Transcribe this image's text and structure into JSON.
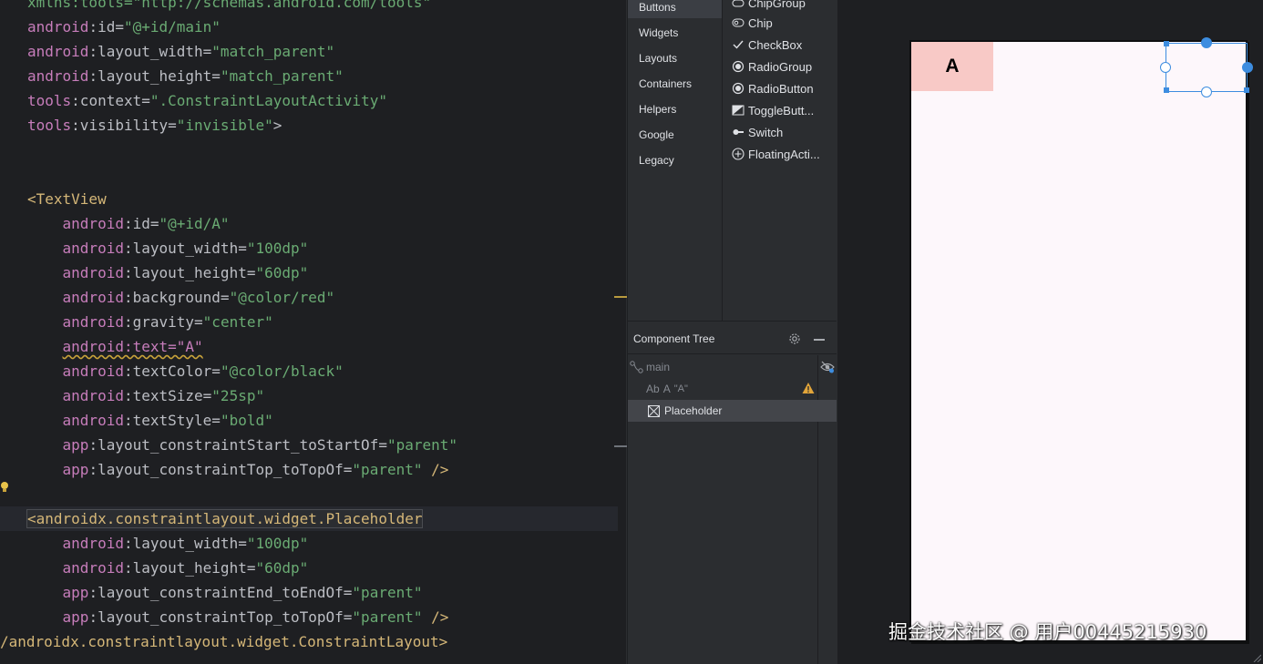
{
  "editor": {
    "lines": [
      [
        {
          "t": "xmlns:tools=\"http://schemas.android.com/tools\"",
          "c": "tok-val"
        }
      ],
      [
        {
          "t": "android",
          "c": "tok-ns"
        },
        {
          "t": ":id=",
          "c": "tok-attr"
        },
        {
          "t": "\"@+id/main\"",
          "c": "tok-val"
        }
      ],
      [
        {
          "t": "android",
          "c": "tok-ns"
        },
        {
          "t": ":layout_width=",
          "c": "tok-attr"
        },
        {
          "t": "\"match_parent\"",
          "c": "tok-val"
        }
      ],
      [
        {
          "t": "android",
          "c": "tok-ns"
        },
        {
          "t": ":layout_height=",
          "c": "tok-attr"
        },
        {
          "t": "\"match_parent\"",
          "c": "tok-val"
        }
      ],
      [
        {
          "t": "tools",
          "c": "tok-ns"
        },
        {
          "t": ":context=",
          "c": "tok-attr"
        },
        {
          "t": "\".ConstraintLayoutActivity\"",
          "c": "tok-val"
        }
      ],
      [
        {
          "t": "tools",
          "c": "tok-ns"
        },
        {
          "t": ":visibility=",
          "c": "tok-attr"
        },
        {
          "t": "\"invisible\"",
          "c": "tok-val"
        },
        {
          "t": ">",
          "c": "tok-punct"
        }
      ],
      [],
      [],
      [
        {
          "t": "<TextView",
          "c": "tok-tag"
        }
      ],
      [
        {
          "t": "    android",
          "c": "tok-ns"
        },
        {
          "t": ":id=",
          "c": "tok-attr"
        },
        {
          "t": "\"@+id/A\"",
          "c": "tok-val"
        }
      ],
      [
        {
          "t": "    android",
          "c": "tok-ns"
        },
        {
          "t": ":layout_width=",
          "c": "tok-attr"
        },
        {
          "t": "\"100dp\"",
          "c": "tok-val"
        }
      ],
      [
        {
          "t": "    android",
          "c": "tok-ns"
        },
        {
          "t": ":layout_height=",
          "c": "tok-attr"
        },
        {
          "t": "\"60dp\"",
          "c": "tok-val"
        }
      ],
      [
        {
          "t": "    android",
          "c": "tok-ns"
        },
        {
          "t": ":background=",
          "c": "tok-attr"
        },
        {
          "t": "\"@color/red\"",
          "c": "tok-val"
        }
      ],
      [
        {
          "t": "    android",
          "c": "tok-ns"
        },
        {
          "t": ":gravity=",
          "c": "tok-attr"
        },
        {
          "t": "\"center\"",
          "c": "tok-val"
        }
      ],
      [
        {
          "t": "    ",
          "c": "tok-ns"
        },
        {
          "t": "android:text=\"A\"",
          "c": "tok-ns squiggle"
        }
      ],
      [
        {
          "t": "    android",
          "c": "tok-ns"
        },
        {
          "t": ":textColor=",
          "c": "tok-attr"
        },
        {
          "t": "\"@color/black\"",
          "c": "tok-val"
        }
      ],
      [
        {
          "t": "    android",
          "c": "tok-ns"
        },
        {
          "t": ":textSize=",
          "c": "tok-attr"
        },
        {
          "t": "\"25sp\"",
          "c": "tok-val"
        }
      ],
      [
        {
          "t": "    android",
          "c": "tok-ns"
        },
        {
          "t": ":textStyle=",
          "c": "tok-attr"
        },
        {
          "t": "\"bold\"",
          "c": "tok-val"
        }
      ],
      [
        {
          "t": "    app",
          "c": "tok-ns"
        },
        {
          "t": ":layout_constraintStart_toStartOf=",
          "c": "tok-attr"
        },
        {
          "t": "\"parent\"",
          "c": "tok-val"
        }
      ],
      [
        {
          "t": "    app",
          "c": "tok-ns"
        },
        {
          "t": ":layout_constraintTop_toTopOf=",
          "c": "tok-attr"
        },
        {
          "t": "\"parent\"",
          "c": "tok-val"
        },
        {
          "t": " />",
          "c": "tok-tag"
        }
      ],
      [],
      [
        {
          "t": "<androidx.constraintlayout.widget.Placeholder",
          "c": "tok-tag tag-box"
        }
      ],
      [
        {
          "t": "    android",
          "c": "tok-ns"
        },
        {
          "t": ":layout_width=",
          "c": "tok-attr"
        },
        {
          "t": "\"100dp\"",
          "c": "tok-val"
        }
      ],
      [
        {
          "t": "    android",
          "c": "tok-ns"
        },
        {
          "t": ":layout_height=",
          "c": "tok-attr"
        },
        {
          "t": "\"60dp\"",
          "c": "tok-val"
        }
      ],
      [
        {
          "t": "    app",
          "c": "tok-ns"
        },
        {
          "t": ":layout_constraintEnd_toEndOf=",
          "c": "tok-attr"
        },
        {
          "t": "\"parent\"",
          "c": "tok-val"
        }
      ],
      [
        {
          "t": "    app",
          "c": "tok-ns"
        },
        {
          "t": ":layout_constraintTop_toTopOf=",
          "c": "tok-attr"
        },
        {
          "t": "\"parent\"",
          "c": "tok-val"
        },
        {
          "t": " />",
          "c": "tok-tag"
        }
      ],
      [
        {
          "t": "/androidx.constraintlayout.widget.ConstraintLayout>",
          "c": "tok-tag"
        }
      ]
    ]
  },
  "palette": {
    "categories": [
      "Buttons",
      "Widgets",
      "Layouts",
      "Containers",
      "Helpers",
      "Google",
      "Legacy"
    ],
    "selected_category": "Buttons",
    "items": [
      {
        "label": "ChipGroup",
        "icon": "chip-group-icon"
      },
      {
        "label": "Chip",
        "icon": "chip-icon"
      },
      {
        "label": "CheckBox",
        "icon": "checkmark-icon"
      },
      {
        "label": "RadioGroup",
        "icon": "radio-group-icon"
      },
      {
        "label": "RadioButton",
        "icon": "radio-button-icon"
      },
      {
        "label": "ToggleButt...",
        "icon": "toggle-button-icon"
      },
      {
        "label": "Switch",
        "icon": "switch-icon"
      },
      {
        "label": "FloatingActi...",
        "icon": "fab-icon"
      }
    ]
  },
  "component_tree": {
    "title": "Component Tree",
    "rows": {
      "main": "main",
      "textview_prefix": "Ab",
      "textview_id": "A",
      "textview_text": "\"A\"",
      "placeholder": "Placeholder"
    }
  },
  "canvas": {
    "textview_label": "A",
    "watermark": "掘金技术社区 @ 用户00445215930"
  },
  "colors": {
    "accent": "#3d8de0",
    "textview_bg": "#f8c9c6",
    "device_bg": "#fdf7fb",
    "warning": "#e2a53a"
  }
}
